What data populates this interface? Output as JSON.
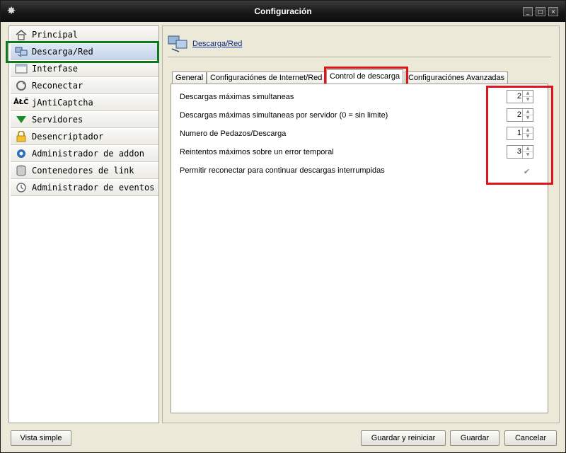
{
  "window": {
    "title": "Configuración",
    "controls": {
      "minimize": "_",
      "maximize": "□",
      "close": "×"
    }
  },
  "sidebar": {
    "items": [
      {
        "label": "Principal",
        "icon": "home-icon"
      },
      {
        "label": "Descarga/Red",
        "icon": "network-icon",
        "selected": true
      },
      {
        "label": "Interfase",
        "icon": "window-icon"
      },
      {
        "label": "Reconectar",
        "icon": "reconnect-icon"
      },
      {
        "label": "jAntiCaptcha",
        "icon": "captcha-icon",
        "icon_text": "ÅŁČ"
      },
      {
        "label": "Servidores",
        "icon": "triangle-down-icon"
      },
      {
        "label": "Desencriptador",
        "icon": "lock-icon"
      },
      {
        "label": "Administrador de addon",
        "icon": "addon-icon"
      },
      {
        "label": "Contenedores de link",
        "icon": "database-icon"
      },
      {
        "label": "Administrador de eventos",
        "icon": "clock-icon"
      }
    ]
  },
  "panel": {
    "title": "Descarga/Red",
    "tabs": [
      {
        "label": "General"
      },
      {
        "label": "Configuraciónes de Internet/Red"
      },
      {
        "label": "Control de descarga",
        "active": true
      },
      {
        "label": "Configuraciónes Avanzadas"
      }
    ],
    "settings": [
      {
        "label": "Descargas máximas simultaneas",
        "value": "2"
      },
      {
        "label": "Descargas máximas simultaneas por servidor (0 = sin limite)",
        "value": "2"
      },
      {
        "label": "Numero de Pedazos/Descarga",
        "value": "1"
      },
      {
        "label": "Reintentos máximos sobre un error temporal",
        "value": "3"
      }
    ],
    "checkbox_setting": {
      "label": "Permitir reconectar para continuar descargas interrumpidas",
      "checked": true
    }
  },
  "footer": {
    "simple_view": "Vista simple",
    "save_restart": "Guardar y reiniciar",
    "save": "Guardar",
    "cancel": "Cancelar"
  },
  "colors": {
    "highlight_green": "#0d7a1f",
    "highlight_red": "#e0151b",
    "titlebar": "#161616"
  }
}
